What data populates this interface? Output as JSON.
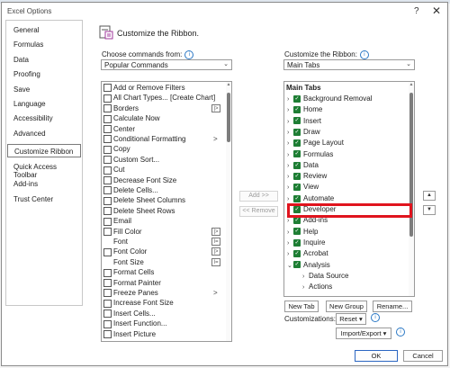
{
  "window": {
    "title": "Excel Options",
    "help": "?",
    "close": "✕"
  },
  "nav": {
    "items": [
      "General",
      "Formulas",
      "Data",
      "Proofing",
      "Save",
      "Language",
      "Accessibility",
      "Advanced",
      "Customize Ribbon",
      "Quick Access Toolbar",
      "Add-ins",
      "Trust Center"
    ],
    "selected": "Customize Ribbon"
  },
  "header": {
    "title": "Customize the Ribbon.",
    "icon": "customize-ribbon-icon"
  },
  "left": {
    "label": "Choose commands from:",
    "dropdown_value": "Popular Commands",
    "commands": [
      {
        "label": "Add or Remove Filters",
        "icon": "filter-icon"
      },
      {
        "label": "All Chart Types... [Create Chart]",
        "icon": "chart-icon"
      },
      {
        "label": "Borders",
        "icon": "borders-icon",
        "sub": "|>"
      },
      {
        "label": "Calculate Now",
        "icon": "calculate-icon"
      },
      {
        "label": "Center",
        "icon": "center-icon"
      },
      {
        "label": "Conditional Formatting",
        "icon": "conditional-formatting-icon",
        "sub": ">"
      },
      {
        "label": "Copy",
        "icon": "copy-icon"
      },
      {
        "label": "Custom Sort...",
        "icon": "sort-icon"
      },
      {
        "label": "Cut",
        "icon": "cut-icon"
      },
      {
        "label": "Decrease Font Size",
        "icon": "decrease-font-icon"
      },
      {
        "label": "Delete Cells...",
        "icon": "delete-cells-icon"
      },
      {
        "label": "Delete Sheet Columns",
        "icon": "delete-columns-icon"
      },
      {
        "label": "Delete Sheet Rows",
        "icon": "delete-rows-icon"
      },
      {
        "label": "Email",
        "icon": "email-icon"
      },
      {
        "label": "Fill Color",
        "icon": "fill-color-icon",
        "sub": "|>"
      },
      {
        "label": "Font",
        "icon": "blank",
        "sub": "I="
      },
      {
        "label": "Font Color",
        "icon": "font-color-icon",
        "sub": "|>"
      },
      {
        "label": "Font Size",
        "icon": "blank",
        "sub": "I="
      },
      {
        "label": "Format Cells",
        "icon": "format-cells-icon"
      },
      {
        "label": "Format Painter",
        "icon": "format-painter-icon"
      },
      {
        "label": "Freeze Panes",
        "icon": "freeze-panes-icon",
        "sub": ">"
      },
      {
        "label": "Increase Font Size",
        "icon": "increase-font-icon"
      },
      {
        "label": "Insert Cells...",
        "icon": "insert-cells-icon"
      },
      {
        "label": "Insert Function...",
        "icon": "insert-function-icon"
      },
      {
        "label": "Insert Picture",
        "icon": "insert-picture-icon"
      }
    ]
  },
  "middle": {
    "add": "Add >>",
    "remove": "<< Remove"
  },
  "right": {
    "label": "Customize the Ribbon:",
    "dropdown_value": "Main Tabs",
    "tree_header": "Main Tabs",
    "tabs": [
      {
        "label": "Background Removal",
        "checked": true
      },
      {
        "label": "Home",
        "checked": true
      },
      {
        "label": "Insert",
        "checked": true
      },
      {
        "label": "Draw",
        "checked": true
      },
      {
        "label": "Page Layout",
        "checked": true
      },
      {
        "label": "Formulas",
        "checked": true
      },
      {
        "label": "Data",
        "checked": true
      },
      {
        "label": "Review",
        "checked": true
      },
      {
        "label": "View",
        "checked": true
      },
      {
        "label": "Automate",
        "checked": true
      },
      {
        "label": "Developer",
        "checked": true
      },
      {
        "label": "Add-ins",
        "checked": true
      },
      {
        "label": "Help",
        "checked": true
      },
      {
        "label": "Inquire",
        "checked": true
      },
      {
        "label": "Acrobat",
        "checked": true
      },
      {
        "label": "Analysis",
        "checked": true,
        "expanded": true
      }
    ],
    "analysis_children": [
      "Data Source",
      "Actions"
    ],
    "buttons": {
      "new_tab": "New Tab",
      "new_group": "New Group",
      "rename": "Rename..."
    },
    "customizations_label": "Customizations:",
    "reset": "Reset",
    "import_export": "Import/Export"
  },
  "footer": {
    "ok": "OK",
    "cancel": "Cancel"
  },
  "colors": {
    "highlight": "#e0141e",
    "checkbox": "#1e7e34",
    "scrollbar": "#7d7d7d"
  }
}
